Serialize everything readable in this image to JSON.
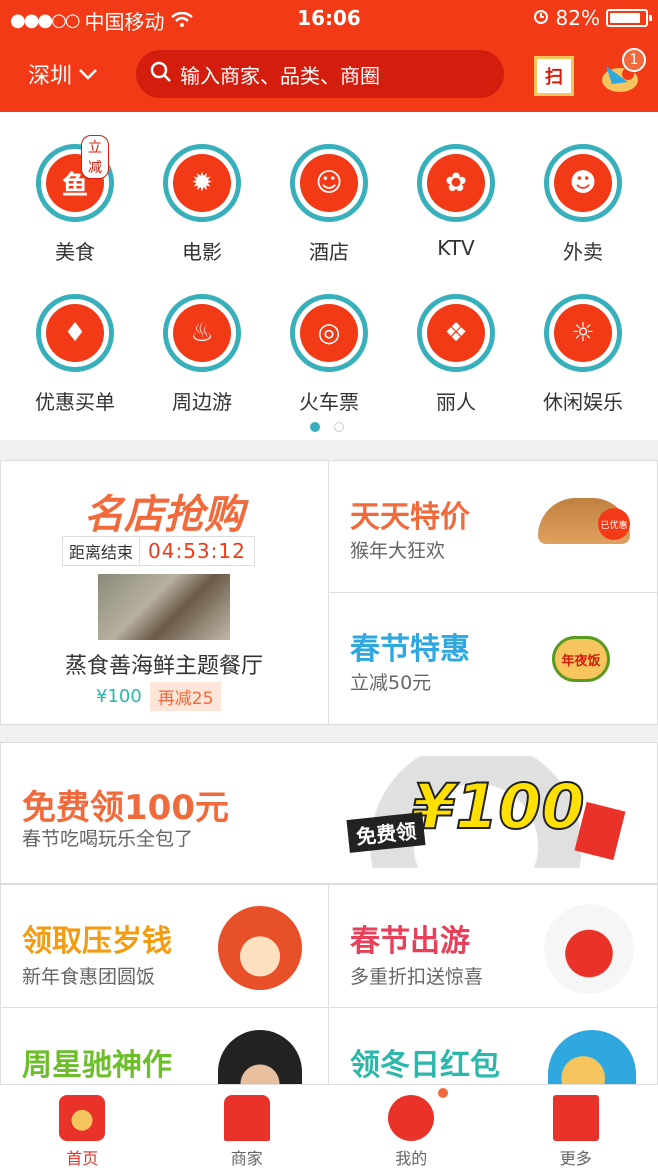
{
  "status_bar": {
    "carrier": "中国移动",
    "time": "16:06",
    "battery": "82%"
  },
  "header": {
    "city": "深圳",
    "search_placeholder": "输入商家、品类、商圈",
    "scan_label": "扫",
    "message_count": "1"
  },
  "categories": [
    {
      "label": "美食",
      "tag": "立减",
      "icon": "fish-icon"
    },
    {
      "label": "电影",
      "icon": "firecracker-icon"
    },
    {
      "label": "酒店",
      "icon": "face-icon"
    },
    {
      "label": "KTV",
      "icon": "knot-icon"
    },
    {
      "label": "外卖",
      "icon": "monkey-icon"
    },
    {
      "label": "优惠买单",
      "icon": "clothes-icon"
    },
    {
      "label": "周边游",
      "icon": "year-pot-icon"
    },
    {
      "label": "火车票",
      "icon": "lantern-icon"
    },
    {
      "label": "丽人",
      "icon": "lion-icon"
    },
    {
      "label": "休闲娱乐",
      "icon": "fortune-god-icon"
    }
  ],
  "flash_sale": {
    "title": "名店抢购",
    "countdown_label": "距离结束",
    "countdown": "04:53:12",
    "shop": "蒸食善海鲜主题餐厅",
    "price": "¥100",
    "discount": "再减25"
  },
  "deals": [
    {
      "title": "天天特价",
      "subtitle": "猴年大狂欢",
      "color": "#f06a3c",
      "image_text": "已优惠"
    },
    {
      "title": "春节特惠",
      "subtitle": "立减50元",
      "color": "#2fa8e0",
      "image_text": "年夜饭"
    }
  ],
  "banner": {
    "title": "免费领100元",
    "subtitle": "春节吃喝玩乐全包了",
    "big_text": "¥100",
    "small_text": "免费领"
  },
  "tiles": [
    {
      "title": "领取压岁钱",
      "subtitle": "新年食惠团圆饭",
      "color": "#f39c12"
    },
    {
      "title": "春节出游",
      "subtitle": "多重折扣送惊喜",
      "color": "#e8405a"
    },
    {
      "title": "周星驰神作",
      "subtitle": "",
      "color": "#6cbf2a"
    },
    {
      "title": "领冬日红包",
      "subtitle": "",
      "color": "#2bb8aa"
    }
  ],
  "nav": [
    {
      "label": "首页",
      "active": true
    },
    {
      "label": "商家"
    },
    {
      "label": "我的"
    },
    {
      "label": "更多"
    }
  ]
}
